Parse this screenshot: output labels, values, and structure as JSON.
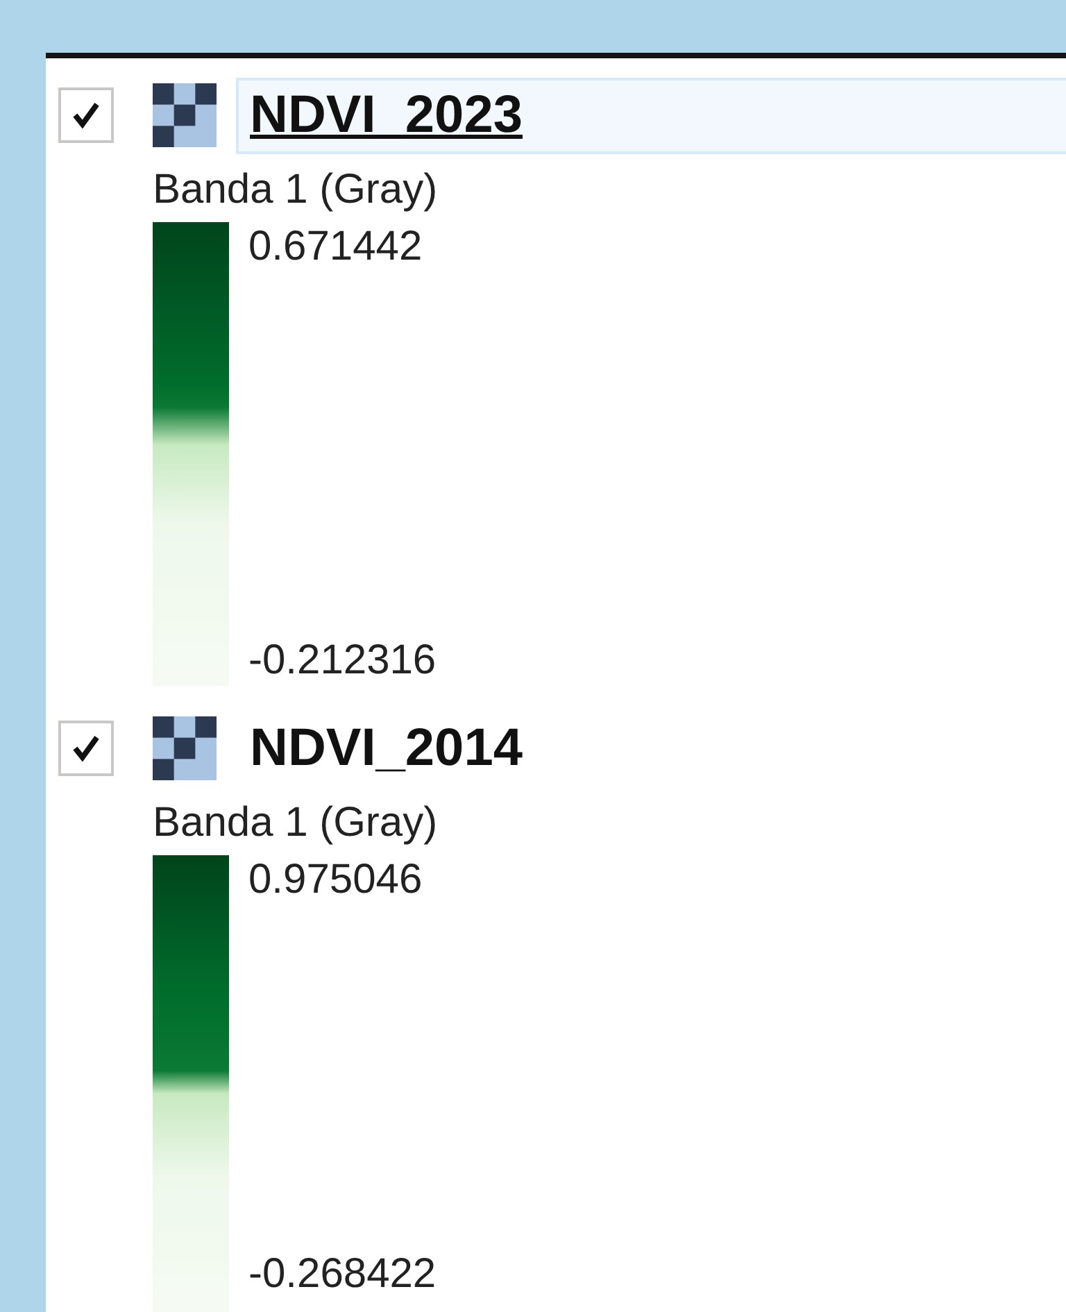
{
  "layers": [
    {
      "name": "NDVI_2023",
      "checked": true,
      "selected": true,
      "band": "Banda 1 (Gray)",
      "max": "0.671442",
      "min": "-0.212316"
    },
    {
      "name": "NDVI_2014",
      "checked": true,
      "selected": false,
      "band": "Banda 1 (Gray)",
      "max": "0.975046",
      "min": "-0.268422"
    }
  ]
}
